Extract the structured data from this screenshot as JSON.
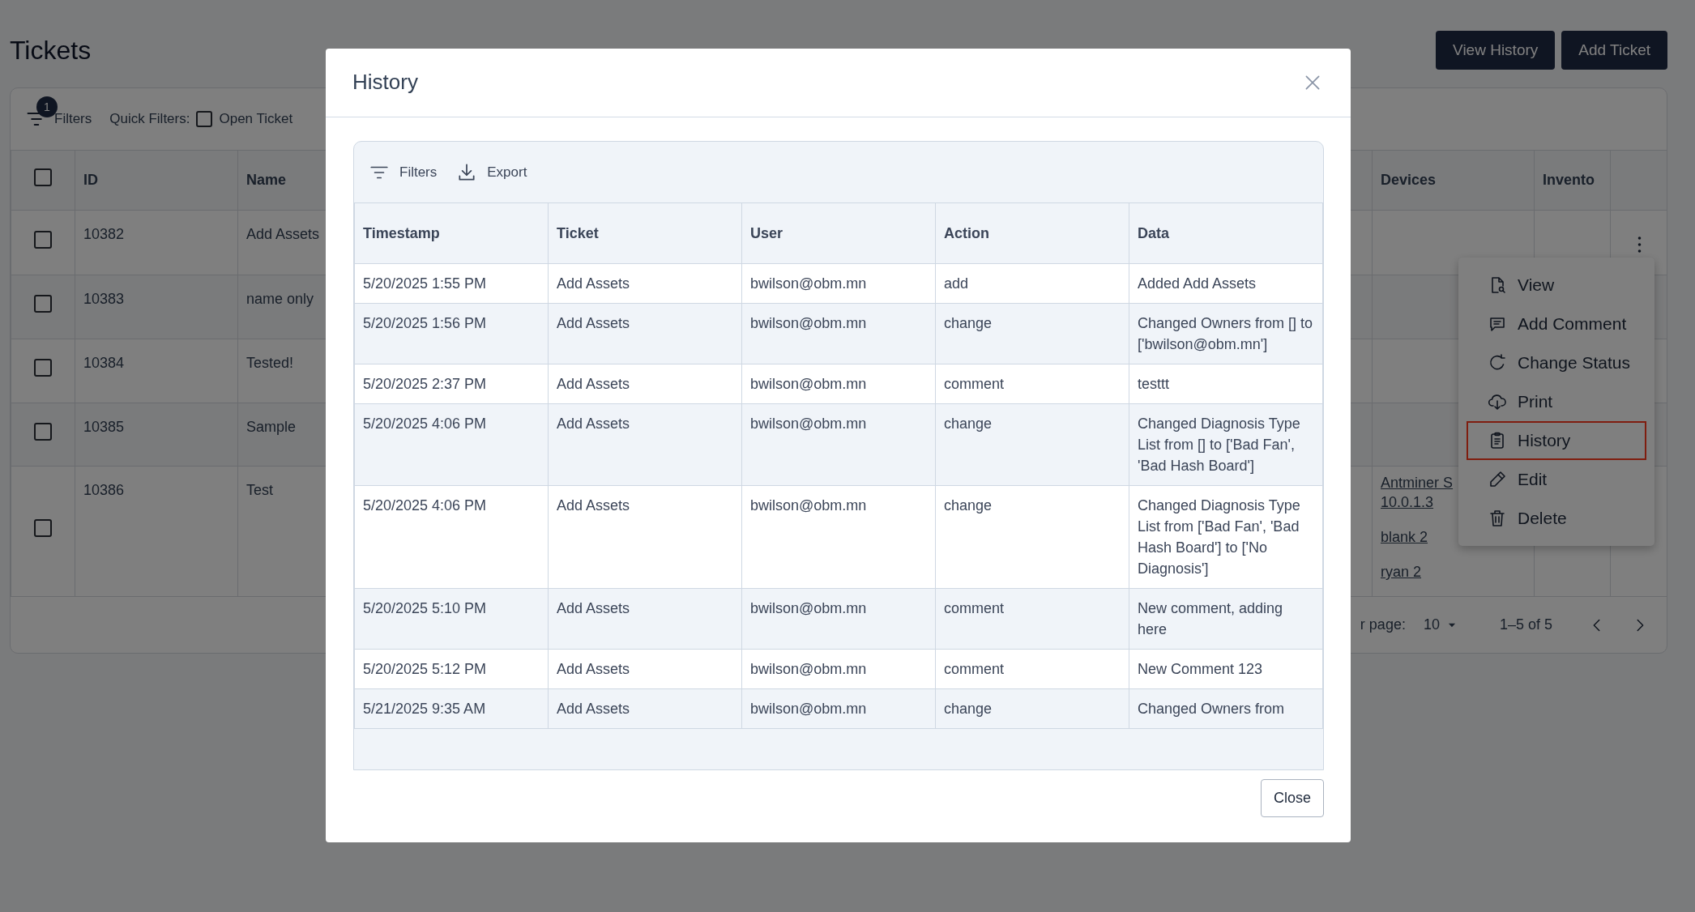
{
  "page": {
    "title": "Tickets",
    "buttons": [
      {
        "label": "View History"
      },
      {
        "label": "Add Ticket"
      }
    ]
  },
  "filter_bar": {
    "filters_label": "Filters",
    "filter_count": "1",
    "quick_filters_label": "Quick Filters:",
    "quick_filters": [
      {
        "label": "Open Ticket",
        "checked": false
      }
    ]
  },
  "tickets_table": {
    "select_all_checked": false,
    "columns": [
      {
        "label": "ID"
      },
      {
        "label": "Name"
      },
      {
        "label": "Devices"
      },
      {
        "label": "Invento"
      }
    ],
    "rows": [
      {
        "checked": false,
        "id": "10382",
        "name": "Add Assets",
        "devices": []
      },
      {
        "checked": false,
        "id": "10383",
        "name": "name only",
        "devices": []
      },
      {
        "checked": false,
        "id": "10384",
        "name": "Tested!",
        "devices": []
      },
      {
        "checked": false,
        "id": "10385",
        "name": "Sample",
        "devices": []
      },
      {
        "checked": false,
        "id": "10386",
        "name": "Test",
        "devices": [
          {
            "label": "Antminer S 10.0.1.3"
          },
          {
            "label": "blank 2"
          },
          {
            "label": "ryan 2"
          }
        ]
      }
    ]
  },
  "pagination": {
    "rows_per_page_label": "r page:",
    "rows_per_page": "10",
    "range": "1–5 of 5"
  },
  "row_menu": {
    "items": [
      {
        "label": "View",
        "kind": "view",
        "selected": false
      },
      {
        "label": "Add Comment",
        "kind": "comment",
        "selected": false
      },
      {
        "label": "Change Status",
        "kind": "status",
        "selected": false
      },
      {
        "label": "Print",
        "kind": "print",
        "selected": false
      },
      {
        "label": "History",
        "kind": "history",
        "selected": true
      },
      {
        "label": "Edit",
        "kind": "edit",
        "selected": false
      },
      {
        "label": "Delete",
        "kind": "delete",
        "selected": false
      }
    ]
  },
  "history_modal": {
    "title": "History",
    "toolbar": [
      {
        "label": "Filters",
        "kind": "filter"
      },
      {
        "label": "Export",
        "kind": "export"
      }
    ],
    "columns": [
      "Timestamp",
      "Ticket",
      "User",
      "Action",
      "Data"
    ],
    "rows": [
      [
        "5/20/2025 1:55 PM",
        "Add Assets",
        "bwilson@obm.mn",
        "add",
        "Added Add Assets"
      ],
      [
        "5/20/2025 1:56 PM",
        "Add Assets",
        "bwilson@obm.mn",
        "change",
        "Changed Owners from [] to ['bwilson@obm.mn']"
      ],
      [
        "5/20/2025 2:37 PM",
        "Add Assets",
        "bwilson@obm.mn",
        "comment",
        "testtt"
      ],
      [
        "5/20/2025 4:06 PM",
        "Add Assets",
        "bwilson@obm.mn",
        "change",
        "Changed Diagnosis Type List from [] to ['Bad Fan', 'Bad Hash Board']"
      ],
      [
        "5/20/2025 4:06 PM",
        "Add Assets",
        "bwilson@obm.mn",
        "change",
        "Changed Diagnosis Type List from ['Bad Fan', 'Bad Hash Board'] to ['No Diagnosis']"
      ],
      [
        "5/20/2025 5:10 PM",
        "Add Assets",
        "bwilson@obm.mn",
        "comment",
        "New comment, adding here"
      ],
      [
        "5/20/2025 5:12 PM",
        "Add Assets",
        "bwilson@obm.mn",
        "comment",
        "New Comment 123"
      ],
      [
        "5/21/2025 9:35 AM",
        "Add Assets",
        "bwilson@obm.mn",
        "change",
        "Changed Owners from"
      ]
    ],
    "close_button": "Close"
  }
}
